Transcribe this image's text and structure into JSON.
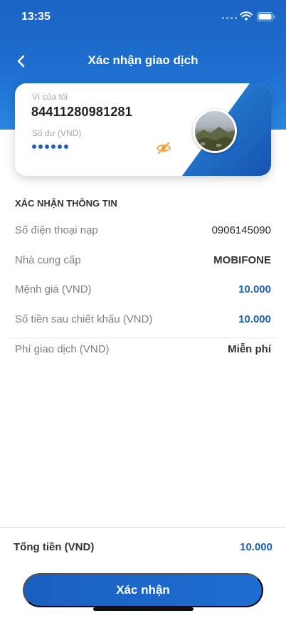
{
  "status_bar": {
    "time": "13:35",
    "icons": [
      "wifi-icon",
      "battery-icon"
    ]
  },
  "nav": {
    "title": "Xác nhận giao dịch",
    "back_icon": "chevron-left-icon"
  },
  "wallet": {
    "label": "Ví của tôi",
    "number": "84411280981281",
    "balance_label": "Số dư (VND)",
    "balance_masked_dots": 6,
    "eye_icon": "eye-off-icon"
  },
  "section": {
    "title": "XÁC NHẬN THÔNG TIN"
  },
  "rows": [
    {
      "label": "Số điện thoại nạp",
      "value": "0906145090"
    },
    {
      "label": "Nhà cung cấp",
      "value": "MOBIFONE"
    },
    {
      "label": "Mệnh giá (VND)",
      "value": "10.000"
    },
    {
      "label": "Số tiền sau chiết khấu (VND)",
      "value": "10.000"
    },
    {
      "label": "Phí giao dịch (VND)",
      "value": "Miễn phí"
    }
  ],
  "total": {
    "label": "Tổng tiền (VND)",
    "value": "10.000"
  },
  "confirm_button": {
    "label": "Xác nhận"
  },
  "colors": {
    "primary": "#1b5fb8",
    "header": "#1e6fd0",
    "accent_orange": "#f0a23b"
  }
}
